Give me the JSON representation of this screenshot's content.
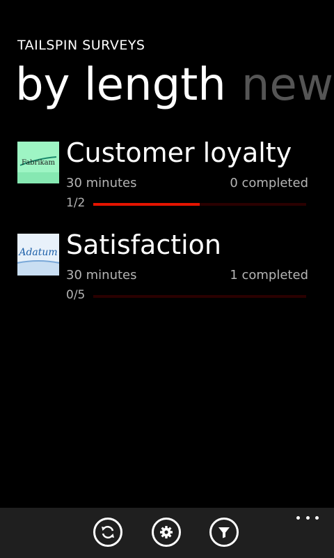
{
  "app": {
    "title": "TAILSPIN SURVEYS"
  },
  "pivot": {
    "active": "by length",
    "next": "new"
  },
  "surveys": [
    {
      "title": "Customer loyalty",
      "length": "30 minutes",
      "completed": "0 completed",
      "progress_label": "1/2",
      "progress": 0.5,
      "logo": {
        "icon": "fabrikam-logo",
        "text": "Fabrikam",
        "background": "#9ef5c4",
        "text_color": "#1a1a1a"
      }
    },
    {
      "title": "Satisfaction",
      "length": "30 minutes",
      "completed": "1 completed",
      "progress_label": "0/5",
      "progress": 0.0,
      "logo": {
        "icon": "adatum-logo",
        "text": "Adatum",
        "background": "#e8f1fa",
        "text_color": "#1c5fa8"
      }
    }
  ],
  "app_bar": {
    "buttons": [
      {
        "icon": "refresh-icon"
      },
      {
        "icon": "settings-icon"
      },
      {
        "icon": "filter-icon"
      }
    ],
    "more_icon": "ellipsis-icon"
  },
  "colors": {
    "accent": "#e51400",
    "background": "#000000",
    "app_bar_background": "#1f1f1f",
    "secondary_text": "#b5b5b5"
  }
}
